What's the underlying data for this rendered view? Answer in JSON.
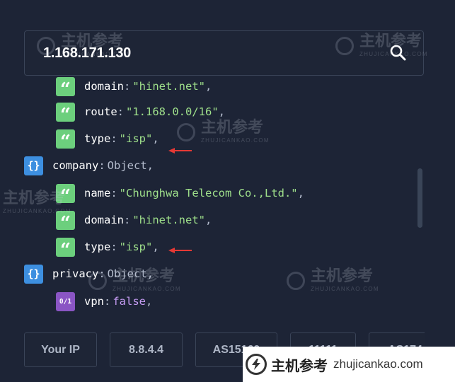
{
  "search": {
    "value": "1.168.171.130"
  },
  "icons": {
    "search": "search-icon",
    "string": "quote-icon",
    "object": "braces-icon",
    "boolean": "bool-01-icon"
  },
  "json_rows": [
    {
      "key": "domain",
      "colon": ":",
      "value": "\"hinet.net\"",
      "trail": ","
    },
    {
      "key": "route",
      "colon": ":",
      "value": "\"1.168.0.0/16\"",
      "trail": ","
    },
    {
      "key": "type",
      "colon": ":",
      "value": "\"isp\"",
      "trail": ","
    },
    {
      "key": "company",
      "colon": ":",
      "value": "Object",
      "trail": ","
    },
    {
      "key": "name",
      "colon": ":",
      "value": "\"Chunghwa Telecom Co.,Ltd.\"",
      "trail": ","
    },
    {
      "key": "domain",
      "colon": ":",
      "value": "\"hinet.net\"",
      "trail": ","
    },
    {
      "key": "type",
      "colon": ":",
      "value": "\"isp\"",
      "trail": ","
    },
    {
      "key": "privacy",
      "colon": ":",
      "value": "Object",
      "trail": ","
    },
    {
      "key": "vpn",
      "colon": ":",
      "value": "false",
      "trail": ","
    }
  ],
  "badges": {
    "boolean_text": "0/1"
  },
  "chips": [
    "Your IP",
    "8.8.4.4",
    "AS15169",
    "11111",
    "AS174"
  ],
  "watermark": {
    "cn": "主机参考",
    "en": "ZHUJICANKAO.COM",
    "footer_url": "zhujicankao.com"
  },
  "colors": {
    "background": "#1d2436",
    "string": "#9fe08b",
    "quote_badge": "#6ccf7d",
    "object_badge": "#3d8fe0",
    "boolean_badge": "#8a55c4",
    "arrow": "#e53935"
  }
}
